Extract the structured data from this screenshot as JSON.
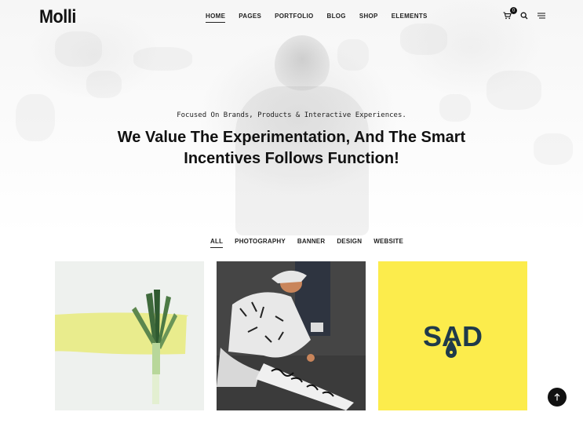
{
  "brand": {
    "logo": "Molli"
  },
  "nav": {
    "items": [
      {
        "label": "HOME",
        "active": true
      },
      {
        "label": "PAGES"
      },
      {
        "label": "PORTFOLIO"
      },
      {
        "label": "BLOG"
      },
      {
        "label": "SHOP"
      },
      {
        "label": "ELEMENTS"
      }
    ]
  },
  "header_icons": {
    "cart": {
      "icon": "cart-icon",
      "count": "0"
    },
    "search": {
      "icon": "search-icon"
    },
    "menu": {
      "icon": "hamburger-menu-icon"
    }
  },
  "hero": {
    "subtitle": "Focused On Brands, Products & Interactive Experiences.",
    "title_line1": "We Value The Experimentation, And The Smart",
    "title_line2": "Incentives Follows Function!"
  },
  "filters": [
    {
      "label": "ALL",
      "active": true
    },
    {
      "label": "PHOTOGRAPHY"
    },
    {
      "label": "BANNER"
    },
    {
      "label": "DESIGN"
    },
    {
      "label": "WEBSITE"
    }
  ],
  "gallery": [
    {
      "name": "leek-on-yellow-stroke"
    },
    {
      "name": "artist-drawing-doodles"
    },
    {
      "name": "sad-logo-on-yellow",
      "text": "SAD"
    }
  ],
  "colors": {
    "accent_yellow": "#fcec4c",
    "dark": "#111111"
  },
  "back_to_top": {
    "icon": "arrow-up-icon"
  }
}
